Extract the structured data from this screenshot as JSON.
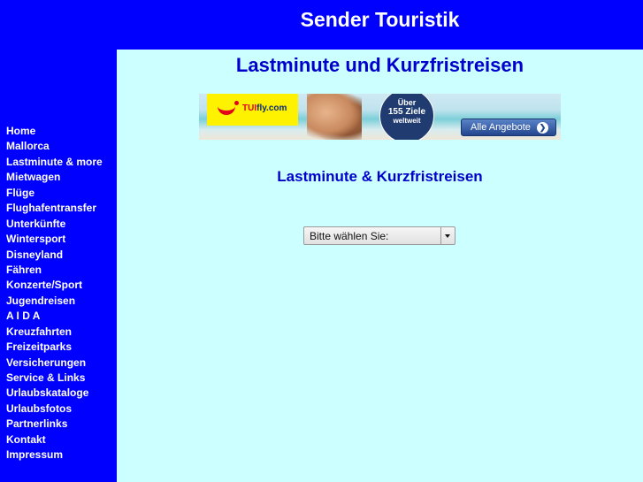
{
  "header": {
    "site_title": "Sender Touristik"
  },
  "colors": {
    "frame_blue": "#0000FF",
    "content_bg": "#CCFFFF",
    "heading_blue": "#0000CC",
    "nav_text": "#FFFFFF"
  },
  "sidebar": {
    "items": [
      {
        "label": "Home"
      },
      {
        "label": "Mallorca"
      },
      {
        "label": "Lastminute & more"
      },
      {
        "label": "Mietwagen"
      },
      {
        "label": "Flüge"
      },
      {
        "label": "Flughafentransfer"
      },
      {
        "label": "Unterkünfte"
      },
      {
        "label": "Wintersport"
      },
      {
        "label": "Disneyland"
      },
      {
        "label": "Fähren"
      },
      {
        "label": "Konzerte/Sport"
      },
      {
        "label": "Jugendreisen"
      },
      {
        "label": "A I D A"
      },
      {
        "label": "Kreuzfahrten"
      },
      {
        "label": "Freizeitparks"
      },
      {
        "label": "Versicherungen"
      },
      {
        "label": "Service & Links"
      },
      {
        "label": "Urlaubskataloge"
      },
      {
        "label": "Urlaubsfotos"
      },
      {
        "label": "Partnerlinks"
      },
      {
        "label": "Kontakt"
      },
      {
        "label": "Impressum"
      }
    ]
  },
  "main": {
    "page_title": "Lastminute und Kurzfristreisen",
    "banner": {
      "brand_prefix": "TUI",
      "brand_suffix": "fly.com",
      "badge_line1": "Über",
      "badge_line2": "155 Ziele",
      "badge_line3": "weltweit",
      "cta_label": "Alle Angebote",
      "cta_icon": "chevron-right-icon"
    },
    "subtitle": "Lastminute & Kurzfristreisen",
    "select": {
      "selected": "Bitte wählen Sie:"
    }
  }
}
